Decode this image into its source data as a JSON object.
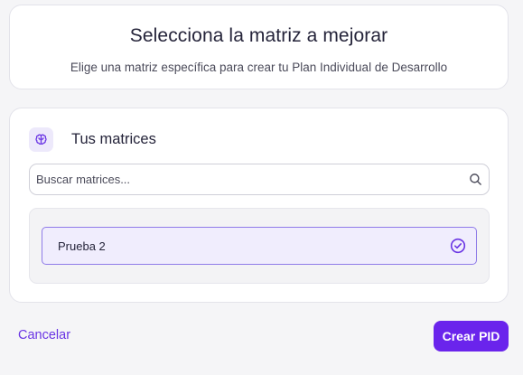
{
  "header": {
    "title": "Selecciona la matriz a mejorar",
    "subtitle": "Elige una matriz específica para crear tu Plan Individual de Desarrollo"
  },
  "matrices_panel": {
    "icon": "brain-icon",
    "title": "Tus matrices",
    "search": {
      "placeholder": "Buscar matrices...",
      "value": "",
      "icon": "search-icon"
    },
    "items": [
      {
        "label": "Prueba 2",
        "selected": true,
        "icon": "check-circle-icon"
      }
    ]
  },
  "footer": {
    "cancel_label": "Cancelar",
    "create_label": "Crear PID"
  },
  "colors": {
    "accent": "#6a24ec",
    "accent_text": "#6a35e4",
    "selected_bg": "#f0edfd",
    "selected_border": "#8f7be8",
    "icon_bg": "#ede9fb",
    "page_bg": "#f5f5f7"
  }
}
